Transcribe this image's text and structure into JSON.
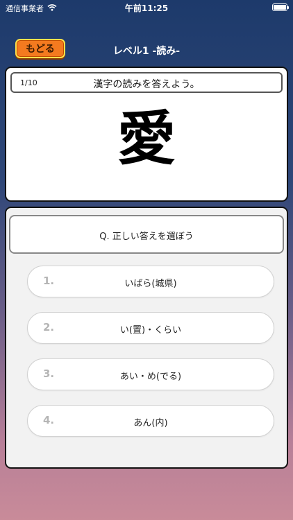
{
  "status_bar": {
    "carrier": "通信事業者",
    "wifi_icon": "wifi-icon",
    "time": "午前11:25",
    "battery_icon": "battery-icon"
  },
  "nav": {
    "back_label": "もどる",
    "title": "レベル1 -読み-"
  },
  "question": {
    "counter": "1/10",
    "prompt": "漢字の読みを答えよう。",
    "kanji": "愛"
  },
  "answers": {
    "instruction": "Q. 正しい答えを選ぼう",
    "choices": [
      {
        "number": "1.",
        "text": "いばら(城県)"
      },
      {
        "number": "2.",
        "text": "い(置)・くらい"
      },
      {
        "number": "3.",
        "text": "あい・め(でる)"
      },
      {
        "number": "4.",
        "text": "あん(内)"
      }
    ]
  },
  "colors": {
    "background_top": "#1d3a6b",
    "background_bottom": "#c98b99",
    "back_button": "#f47a1f",
    "back_button_border": "#ffe14a"
  }
}
